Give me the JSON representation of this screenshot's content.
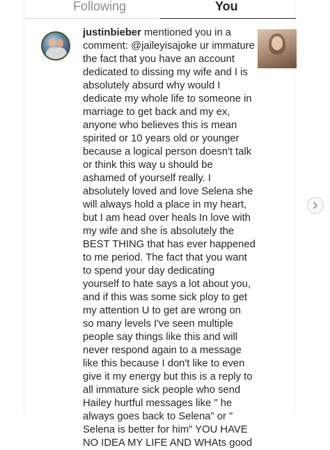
{
  "tabs": [
    {
      "label": "Following"
    },
    {
      "label": "You"
    }
  ],
  "notification": {
    "username": "justinbieber",
    "text": " mentioned you in a\ncomment: @jaileyisajoke ur immature\nthe fact that you have an account\ndedicated to dissing my wife and I is\nabsolutely absurd why would I\ndedicate my whole life to someone in\nmarriage to get back and my ex,\nanyone who believes this is mean\nspirited or 10 years old or younger\nbecause a logical person doesn't talk\nor think this way u should be\nashamed of yourself really. I\nabsolutely loved and love Selena she\nwill always hold a place in my heart,\nbut I am head over heals In love with\nmy wife and she is absolutely the\nBEST THING that has ever happened\nto me period. The fact that you want\nto spend your day dedicating\nyourself to hate says a lot about you,\nand if this was some sick ploy to get\nmy attention U to get are wrong on\nso many levels I've seen multiple\npeople say things like this and will\nnever respond again to a message\nlike this because I don't like to even\ngive it my energy but this is a reply to\nall immature sick people who send\nHailey hurtful messages like \" he\nalways goes back to Selena\" or \"\nSelena is better for him\" YOU HAVE\nNO IDEA MY LIFE AND WHAts good"
  },
  "icons": {
    "avatar": "profile-avatar",
    "thumbnail": "post-thumbnail",
    "next": "chevron-right-icon"
  },
  "colors": {
    "text": "#262626",
    "muted": "#8e8e8e",
    "divider": "#dbdbdb"
  }
}
